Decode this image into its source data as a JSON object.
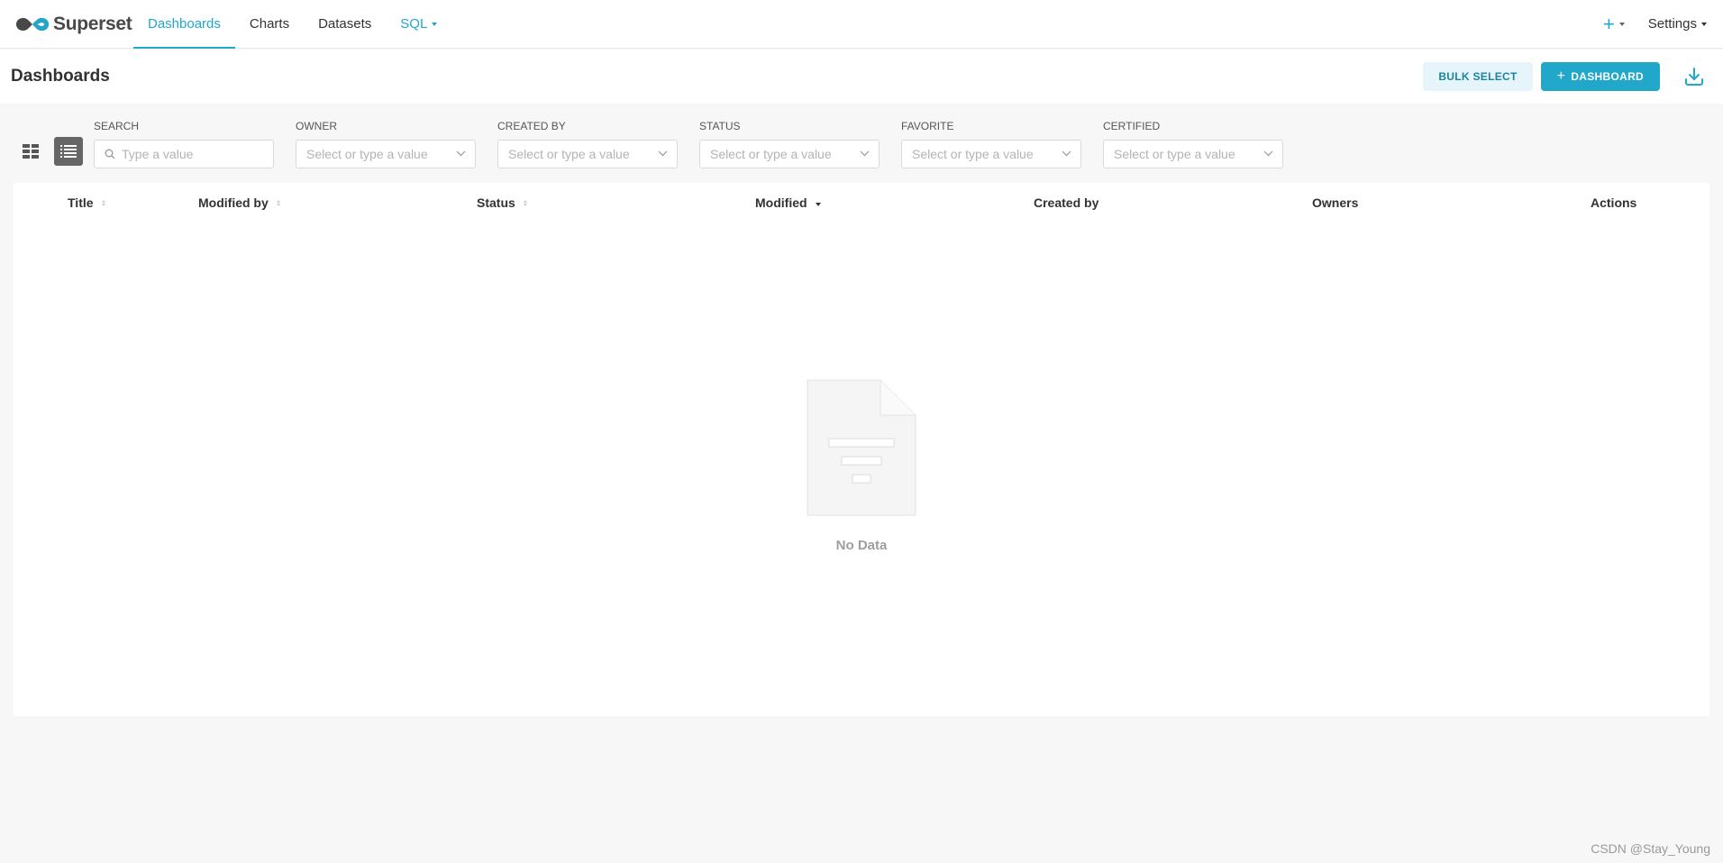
{
  "brand": {
    "name": "Superset"
  },
  "nav": {
    "items": [
      {
        "label": "Dashboards"
      },
      {
        "label": "Charts"
      },
      {
        "label": "Datasets"
      },
      {
        "label": "SQL"
      }
    ],
    "settings_label": "Settings",
    "plus_label": "+"
  },
  "header": {
    "title": "Dashboards",
    "bulk_select_label": "BULK SELECT",
    "add_dashboard_label": "DASHBOARD",
    "add_dashboard_plus": "+"
  },
  "filters": {
    "search": {
      "label": "SEARCH",
      "placeholder": "Type a value"
    },
    "owner": {
      "label": "OWNER",
      "placeholder": "Select or type a value"
    },
    "created_by": {
      "label": "CREATED BY",
      "placeholder": "Select or type a value"
    },
    "status": {
      "label": "STATUS",
      "placeholder": "Select or type a value"
    },
    "favorite": {
      "label": "FAVORITE",
      "placeholder": "Select or type a value"
    },
    "certified": {
      "label": "CERTIFIED",
      "placeholder": "Select or type a value"
    }
  },
  "table": {
    "columns": [
      "Title",
      "Modified by",
      "Status",
      "Modified",
      "Created by",
      "Owners",
      "Actions"
    ],
    "empty_text": "No Data"
  },
  "colors": {
    "accent": "#20a7c9",
    "accent_light": "#e5f5f9"
  },
  "watermark": "CSDN @Stay_Young"
}
